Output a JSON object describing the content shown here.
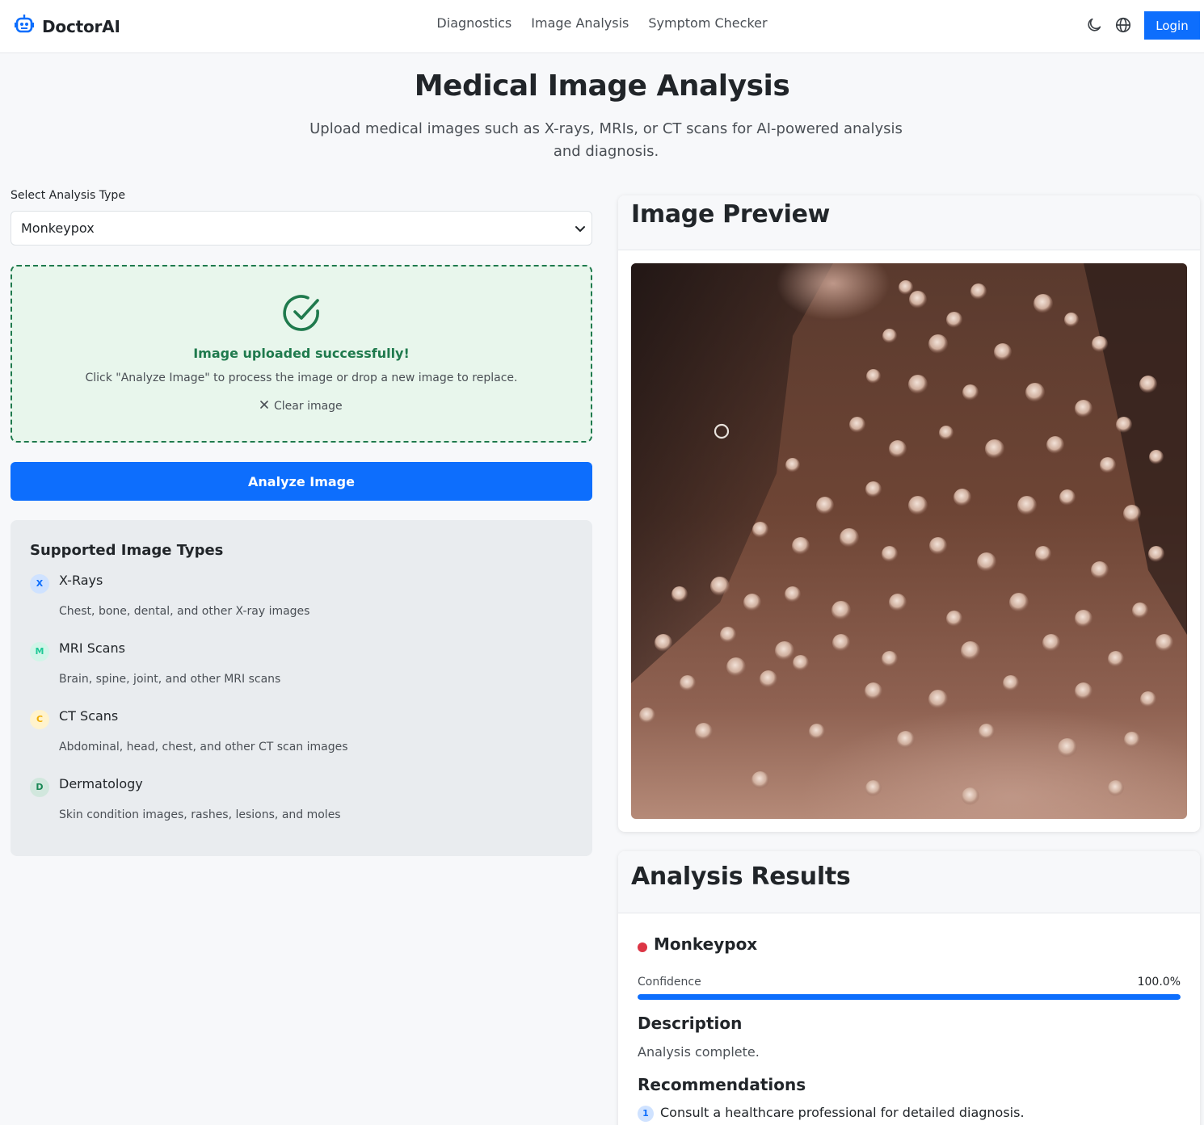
{
  "brand": {
    "name": "DoctorAI",
    "icon": "robot-icon",
    "color": "#0d6efd"
  },
  "nav": {
    "links": [
      {
        "label": "Diagnostics"
      },
      {
        "label": "Image Analysis"
      },
      {
        "label": "Symptom Checker"
      }
    ],
    "theme_icon": "moon-icon",
    "language_icon": "globe-icon",
    "login_label": "Login"
  },
  "hero": {
    "title": "Medical Image Analysis",
    "subtitle": "Upload medical images such as X-rays, MRIs, or CT scans for AI-powered analysis and diagnosis."
  },
  "analysis_type": {
    "label": "Select Analysis Type",
    "selected": "Monkeypox"
  },
  "upload": {
    "status_icon": "check-circle-icon",
    "success_message": "Image uploaded successfully!",
    "hint": "Click \"Analyze Image\" to process the image or drop a new image to replace.",
    "clear_label": "Clear image"
  },
  "analyze_button_label": "Analyze Image",
  "supported_types": {
    "title": "Supported Image Types",
    "items": [
      {
        "badge": "X",
        "name": "X-Rays",
        "description": "Chest, bone, dental, and other X-ray images",
        "badge_bg": "#cfe2ff",
        "badge_color": "#0d6efd"
      },
      {
        "badge": "M",
        "name": "MRI Scans",
        "description": "Brain, spine, joint, and other MRI scans",
        "badge_bg": "#d1f5e8",
        "badge_color": "#20c997"
      },
      {
        "badge": "C",
        "name": "CT Scans",
        "description": "Abdominal, head, chest, and other CT scan images",
        "badge_bg": "#fff3cd",
        "badge_color": "#f0ad00"
      },
      {
        "badge": "D",
        "name": "Dermatology",
        "description": "Skin condition images, rashes, lesions, and moles",
        "badge_bg": "#d1e7dd",
        "badge_color": "#198754"
      }
    ]
  },
  "preview": {
    "title": "Image Preview"
  },
  "results": {
    "title": "Analysis Results",
    "diagnosis": "Monkeypox",
    "status_color": "#dc3545",
    "confidence_label": "Confidence",
    "confidence_value": "100.0%",
    "confidence_fraction": 1.0,
    "description_title": "Description",
    "description": "Analysis complete.",
    "recommendations_title": "Recommendations",
    "recommendations": [
      {
        "number": "1",
        "text": "Consult a healthcare professional for detailed diagnosis."
      }
    ]
  }
}
